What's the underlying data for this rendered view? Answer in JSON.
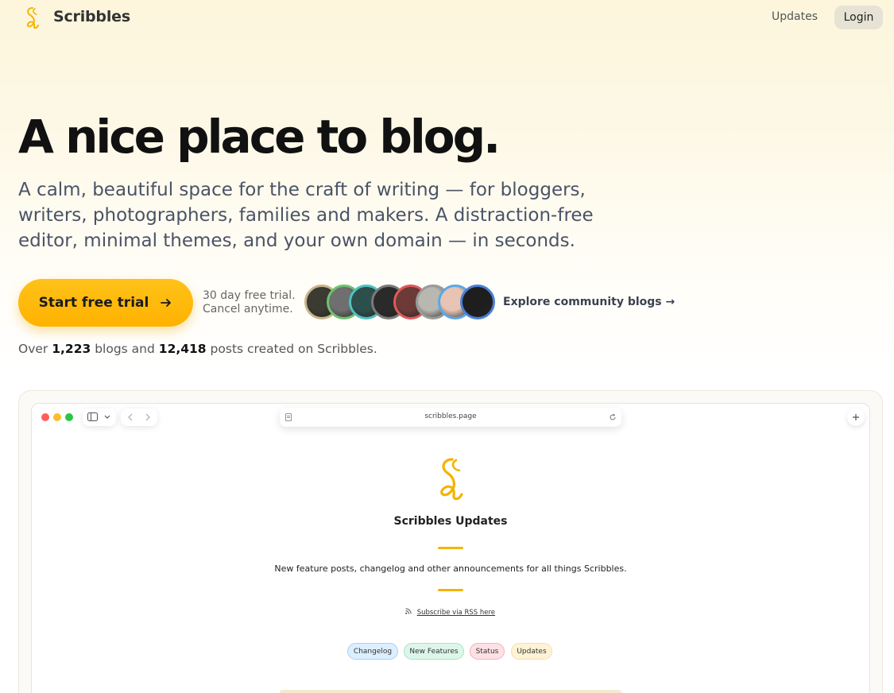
{
  "header": {
    "brand": "Scribbles",
    "nav_updates": "Updates",
    "nav_login": "Login"
  },
  "hero": {
    "title": "A nice place to blog.",
    "subtitle_lines": [
      "A calm, beautiful space for the craft of writing — for bloggers,",
      "writers, photographers, families and makers. A distraction-free",
      "editor, minimal themes, and your own domain — in seconds."
    ]
  },
  "cta": {
    "button_label": "Start free trial",
    "trial_line1": "30 day free trial.",
    "trial_line2": "Cancel anytime.",
    "explore_label": "Explore community blogs →"
  },
  "stats": {
    "prefix": "Over",
    "blogs": "1,223",
    "middle": "blogs and",
    "posts": "12,418",
    "suffix": "posts created on Scribbles."
  },
  "avatars": [
    {
      "ring": "#c9b48a",
      "fill": "#3b3a33"
    },
    {
      "ring": "#6fc16f",
      "fill": "#6f6f6f"
    },
    {
      "ring": "#4fc2c2",
      "fill": "#2d4f4b"
    },
    {
      "ring": "#7a7a7a",
      "fill": "#2a2a2a"
    },
    {
      "ring": "#e05a5a",
      "fill": "#6c3b38"
    },
    {
      "ring": "#9a9a9a",
      "fill": "#b8b8b0"
    },
    {
      "ring": "#5aa8e6",
      "fill": "#e8c4b4"
    },
    {
      "ring": "#4a7fd6",
      "fill": "#1e1e1e"
    }
  ],
  "mockup": {
    "url": "scribbles.page",
    "site_title": "Scribbles Updates",
    "site_description": "New feature posts, changelog and other announcements for all things Scribbles.",
    "rss_label": "Subscribe via RSS here",
    "tags": [
      {
        "label": "Changelog",
        "bg": "#dcefff",
        "border": "#a9d0f2"
      },
      {
        "label": "New Features",
        "bg": "#dcf7ea",
        "border": "#a8e3c6"
      },
      {
        "label": "Status",
        "bg": "#fde1e4",
        "border": "#f3b3bb"
      },
      {
        "label": "Updates",
        "bg": "#fff3d6",
        "border": "#f6e0a8"
      }
    ]
  },
  "colors": {
    "accent": "#ffb800",
    "traffic_red": "#ff5f57",
    "traffic_yellow": "#febc2e",
    "traffic_green": "#28c840"
  }
}
